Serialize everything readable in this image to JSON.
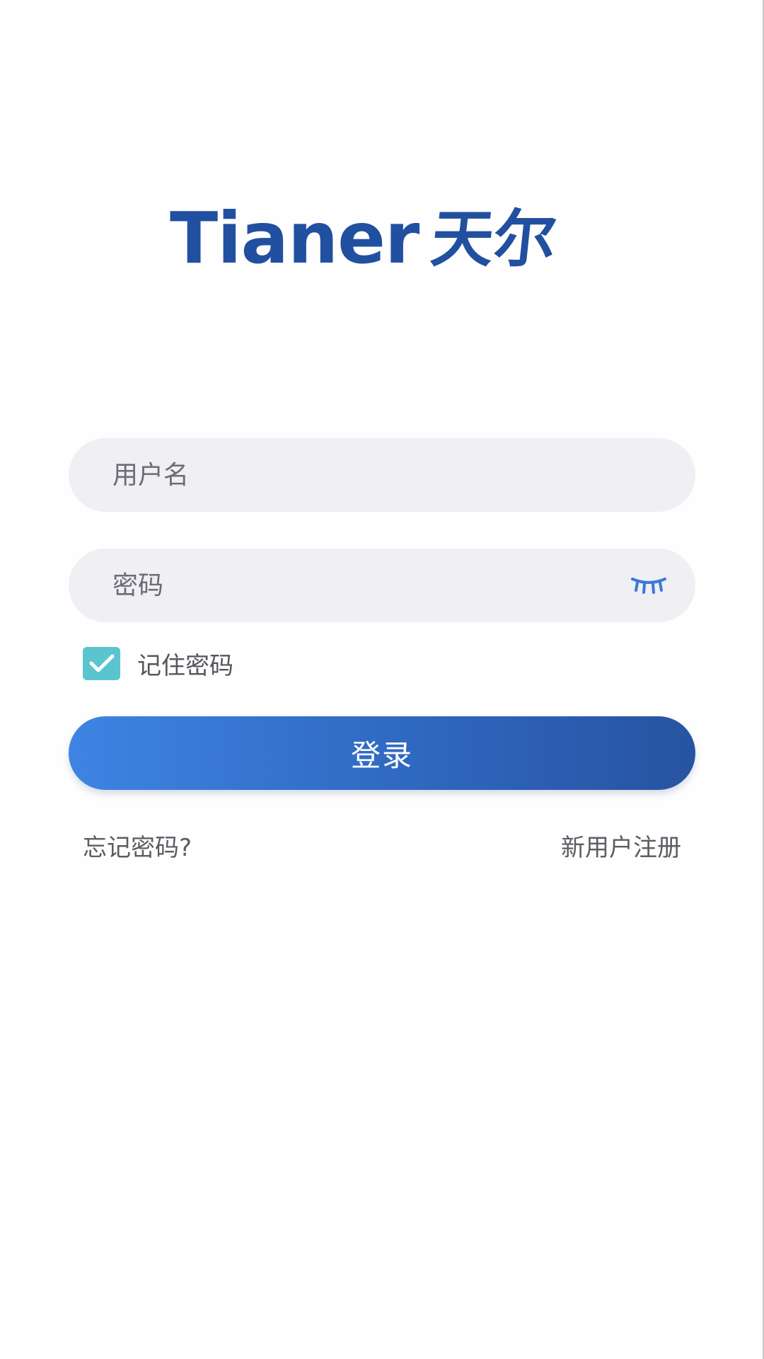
{
  "logo": {
    "latin": "Tianer",
    "cjk": "天尔",
    "color": "#2250a0"
  },
  "form": {
    "username": {
      "value": "",
      "placeholder": "用户名"
    },
    "password": {
      "value": "",
      "placeholder": "密码",
      "toggle_icon": "eye-closed-icon"
    },
    "remember": {
      "label": "记住密码",
      "checked": true,
      "icon": "check-icon"
    },
    "login_label": "登录"
  },
  "links": {
    "forgot": "忘记密码?",
    "register": "新用户注册"
  },
  "colors": {
    "accent_start": "#3e84e3",
    "accent_end": "#2753a2",
    "checkbox": "#5bc5cf",
    "field_bg": "#efeff4"
  }
}
